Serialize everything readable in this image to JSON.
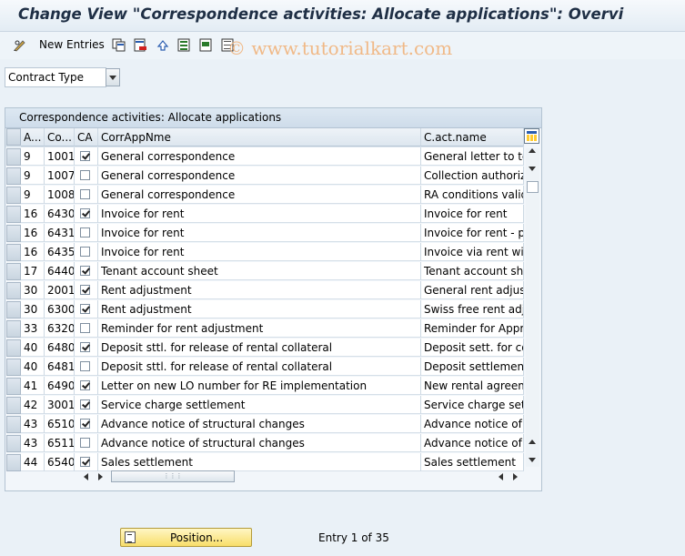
{
  "window": {
    "title": "Change View \"Correspondence activities: Allocate applications\": Overvi"
  },
  "toolbar": {
    "new_entries_label": "New Entries"
  },
  "watermark": "© www.tutorialkart.com",
  "filter": {
    "contract_type_value": "Contract Type"
  },
  "table": {
    "title": "Correspondence activities: Allocate applications",
    "columns": [
      "A...",
      "Co...",
      "CA",
      "CorrAppNme",
      "C.act.name"
    ],
    "rows": [
      {
        "a": "9",
        "co": "1001",
        "ca": true,
        "name": "General correspondence",
        "act": "General letter to ten"
      },
      {
        "a": "9",
        "co": "1007",
        "ca": false,
        "name": "General correspondence",
        "act": "Collection authorizat"
      },
      {
        "a": "9",
        "co": "1008",
        "ca": false,
        "name": "General correspondence",
        "act": "RA conditions valid o"
      },
      {
        "a": "16",
        "co": "6430",
        "ca": true,
        "name": "Invoice for rent",
        "act": "Invoice for rent"
      },
      {
        "a": "16",
        "co": "6431",
        "ca": false,
        "name": "Invoice for rent",
        "act": "Invoice for rent - pa"
      },
      {
        "a": "16",
        "co": "6435",
        "ca": false,
        "name": "Invoice for rent",
        "act": "Invoice via rent with"
      },
      {
        "a": "17",
        "co": "6440",
        "ca": true,
        "name": "Tenant account sheet",
        "act": "Tenant account she"
      },
      {
        "a": "30",
        "co": "2001",
        "ca": true,
        "name": "Rent adjustment",
        "act": "General rent adjustr"
      },
      {
        "a": "30",
        "co": "6300",
        "ca": true,
        "name": "Rent adjustment",
        "act": "Swiss free rent adju"
      },
      {
        "a": "33",
        "co": "6320",
        "ca": false,
        "name": "Reminder for rent adjustment",
        "act": "Reminder for Appro"
      },
      {
        "a": "40",
        "co": "6480",
        "ca": true,
        "name": "Deposit sttl. for release of rental collateral",
        "act": "Deposit sett. for co"
      },
      {
        "a": "40",
        "co": "6481",
        "ca": false,
        "name": "Deposit sttl. for release of rental collateral",
        "act": "Deposit settlement"
      },
      {
        "a": "41",
        "co": "6490",
        "ca": true,
        "name": "Letter on new LO number for RE implementation",
        "act": "New rental agreeme"
      },
      {
        "a": "42",
        "co": "3001",
        "ca": true,
        "name": "Service charge settlement",
        "act": "Service charge settl"
      },
      {
        "a": "43",
        "co": "6510",
        "ca": true,
        "name": "Advance notice of structural changes",
        "act": "Advance notice of s"
      },
      {
        "a": "43",
        "co": "6511",
        "ca": false,
        "name": "Advance notice of structural changes",
        "act": "Advance notice of s"
      },
      {
        "a": "44",
        "co": "6540",
        "ca": true,
        "name": "Sales settlement",
        "act": "Sales settlement"
      }
    ]
  },
  "footer": {
    "position_button_label": "Position...",
    "entry_info": "Entry 1 of 35"
  }
}
